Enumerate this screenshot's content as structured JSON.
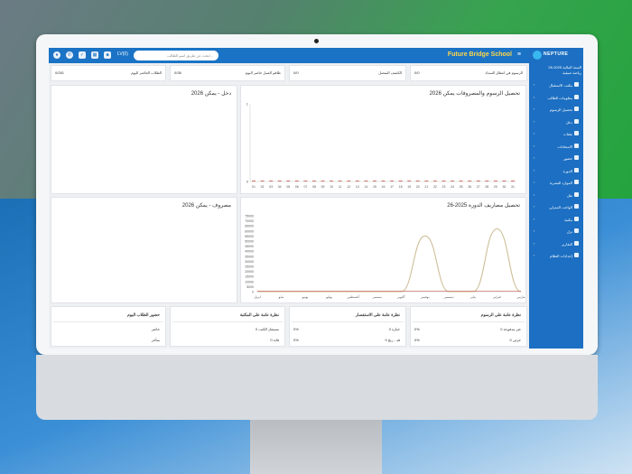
{
  "app": {
    "school_name": "Future Bridge School",
    "search_placeholder": "ابحث عن طريق اسم الطالب...",
    "lang": "LV(0)"
  },
  "sidebar": {
    "brand": "NEPTURE",
    "year_label": "السنة المالية 2025-26",
    "year_sub": "رياضة صيفية",
    "items": [
      {
        "label": "مكتب الاستقبال"
      },
      {
        "label": "معلومات الطالب"
      },
      {
        "label": "تحصيل الرسوم"
      },
      {
        "label": "دخل"
      },
      {
        "label": "نفقات"
      },
      {
        "label": "الامتحانات"
      },
      {
        "label": "حضور"
      },
      {
        "label": "الدورة"
      },
      {
        "label": "الموارد البشرية"
      },
      {
        "label": "نقل"
      },
      {
        "label": "الواجب المنزلي"
      },
      {
        "label": "مكتبة"
      },
      {
        "label": "نزل"
      },
      {
        "label": "التقارير"
      },
      {
        "label": "إعدادات النظام"
      }
    ]
  },
  "stats": [
    {
      "title": "الرسوم في انتظار السداد",
      "value": "0/0"
    },
    {
      "title": "الكشف المتصل",
      "value": "0/0"
    },
    {
      "title": "طاقم العمل حاضر اليوم",
      "value": "0/38"
    },
    {
      "title": "الطلاب الحاضر اليوم",
      "value": "0/281"
    }
  ],
  "charts": {
    "top_left_title": "تحصيل الرسوم والمصروفات يمكن 2026",
    "top_right_title": "دخل - يمكن 2026",
    "bottom_left_title": "تحصيل مصاريف الدورة 2025-26",
    "bottom_right_title": "مصروف - يمكن 2026"
  },
  "chart_data": [
    {
      "type": "line",
      "x": [
        "01",
        "02",
        "03",
        "04",
        "05",
        "06",
        "07",
        "08",
        "09",
        "10",
        "11",
        "12",
        "13",
        "14",
        "15",
        "16",
        "17",
        "18",
        "19",
        "20",
        "21",
        "22",
        "23",
        "24",
        "25",
        "26",
        "27",
        "28",
        "29",
        "30",
        "31"
      ],
      "y_ticks": [
        "0",
        "1"
      ],
      "ylim": [
        0,
        1
      ]
    },
    {
      "type": "line",
      "categories": [
        "ابريل",
        "مايو",
        "يونيو",
        "يوليو",
        "أغسطس",
        "سبتمبر",
        "أكتوبر",
        "نوفمبر",
        "ديسمبر",
        "يناير",
        "فبراير",
        "مارس"
      ],
      "y_ticks": [
        "0",
        "5000",
        "10000",
        "15000",
        "20000",
        "25000",
        "30000",
        "35000",
        "40000",
        "45000",
        "50000",
        "55000",
        "60000",
        "65000",
        "70000",
        "75000"
      ],
      "ylim": [
        0,
        75000
      ],
      "series": [
        {
          "values": [
            0,
            0,
            0,
            0,
            0,
            0,
            0,
            55000,
            0,
            0,
            62000,
            0
          ]
        }
      ]
    }
  ],
  "bottom": {
    "fees": {
      "title": "نظرة عامة على الرسوم",
      "rows": [
        {
          "label": "غير مدفوعة 0",
          "pct": "0%"
        },
        {
          "label": "جزئي 0",
          "pct": "0%"
        }
      ]
    },
    "enquiry": {
      "title": "نظرة عامة على الاستفسار",
      "rows": [
        {
          "label": "0 خيارة",
          "pct": "0%"
        },
        {
          "label": "0 قد - ربح",
          "pct": "0%"
        }
      ]
    },
    "library": {
      "title": "نظرة عامة على المكتبة",
      "rows": [
        {
          "label": "0 مستعار الكتب",
          "pct": ""
        },
        {
          "label": "0 فاند",
          "pct": ""
        }
      ]
    },
    "attendance": {
      "title": "حضور الطلاب اليوم",
      "rows": [
        {
          "label": "حاضر",
          "pct": ""
        },
        {
          "label": "متأخر",
          "pct": ""
        }
      ]
    }
  }
}
